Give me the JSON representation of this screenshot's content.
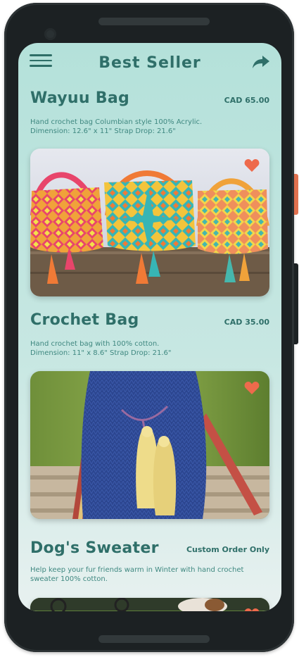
{
  "header": {
    "title": "Best Seller"
  },
  "items": [
    {
      "title": "Wayuu Bag",
      "price": "CAD 65.00",
      "desc1": "Hand crochet bag Columbian style 100% Acrylic.",
      "desc2": "Dimension: 12.6\" x 11\" Strap Drop: 21.6\""
    },
    {
      "title": "Crochet Bag",
      "price": "CAD 35.00",
      "desc1": "Hand crochet bag with 100% cotton.",
      "desc2": "Dimension: 11\" x 8.6\" Strap Drop: 21.6\""
    },
    {
      "title": "Dog's Sweater",
      "price": "Custom Order Only",
      "desc1": "Help keep your fur friends warm in Winter with hand crochet",
      "desc2": "sweater 100% cotton."
    }
  ],
  "colors": {
    "accent": "#2f6f69",
    "heart": "#ee6a4c",
    "background": "#b4e1da"
  },
  "icons": [
    "menu-icon",
    "share-icon",
    "heart-icon"
  ]
}
